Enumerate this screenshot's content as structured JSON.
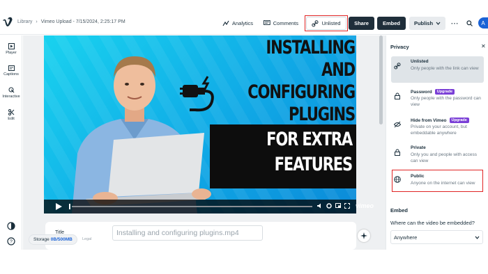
{
  "breadcrumb": {
    "library": "Library",
    "separator": "›",
    "current": "Vimeo Upload - 7/15/2024, 2:25:17 PM"
  },
  "toolbar": {
    "analytics": "Analytics",
    "comments": "Comments",
    "unlisted": "Unlisted",
    "share": "Share",
    "embed": "Embed",
    "publish": "Publish",
    "avatar_initial": "A"
  },
  "sidebar": {
    "items": [
      {
        "label": "Player",
        "icon": "player-icon"
      },
      {
        "label": "Captions",
        "icon": "captions-icon"
      },
      {
        "label": "Interactive",
        "icon": "interactive-icon"
      },
      {
        "label": "Edit",
        "icon": "edit-icon"
      }
    ]
  },
  "video": {
    "thumbnail_title_lines": [
      "INSTALLING AND",
      "CONFIGURING",
      "PLUGINS"
    ],
    "thumbnail_box_lines": [
      "FOR EXTRA",
      "FEATURES"
    ],
    "player_brand": "vimeo"
  },
  "details": {
    "title_label": "Title",
    "title_value": "Installing and configuring plugins.mp4"
  },
  "storage": {
    "label": "Storage",
    "quota": "0B/500MB",
    "legal": "Legal"
  },
  "privacy": {
    "title": "Privacy",
    "options": [
      {
        "name": "Unlisted",
        "desc": "Only people with the link can view",
        "badge": "",
        "selected": true
      },
      {
        "name": "Password",
        "desc": "Only people with the password can view",
        "badge": "Upgrade",
        "selected": false
      },
      {
        "name": "Hide from Vimeo",
        "desc": "Private on your account, but embeddable anywhere",
        "badge": "Upgrade",
        "selected": false
      },
      {
        "name": "Private",
        "desc": "Only you and people with access can view",
        "badge": "",
        "selected": false
      },
      {
        "name": "Public",
        "desc": "Anyone on the internet can view",
        "badge": "",
        "selected": false
      }
    ]
  },
  "embed_section": {
    "title": "Embed",
    "question": "Where can the video be embedded?",
    "selected": "Anywhere"
  },
  "colors": {
    "highlight": "#e02424",
    "brand_dark": "#1f2e3a",
    "upgrade": "#7a3fd6",
    "link": "#1a62d6"
  }
}
